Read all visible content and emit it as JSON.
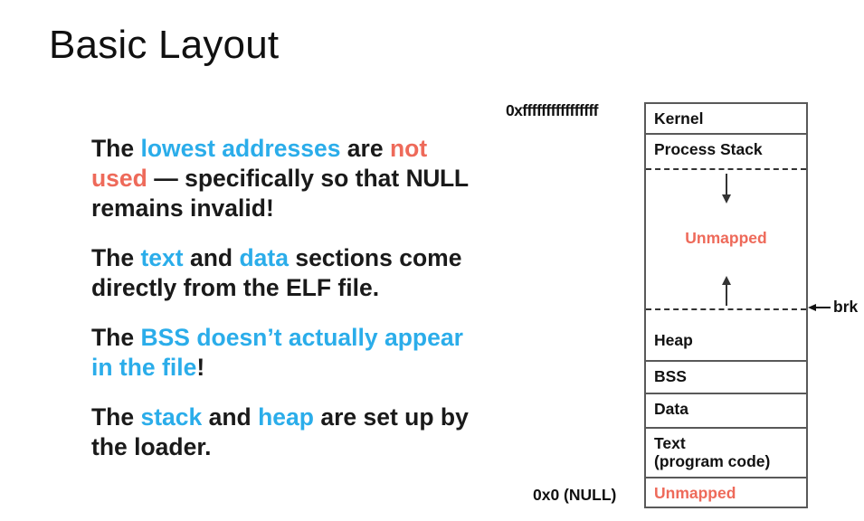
{
  "slide": {
    "title": "Basic Layout"
  },
  "body": {
    "paragraphs": [
      {
        "id": "para-lowest-addresses",
        "segments": [
          {
            "text": "The ",
            "color": "black"
          },
          {
            "text": "lowest addresses",
            "color": "blue"
          },
          {
            "text": " are ",
            "color": "black"
          },
          {
            "text": "not used",
            "color": "red"
          },
          {
            "text": " — specifically so that ",
            "color": "black"
          },
          {
            "text": "NULL",
            "color": "black",
            "style": "mono"
          },
          {
            "text": " remains invalid!",
            "color": "black"
          }
        ]
      },
      {
        "id": "para-text-data",
        "segments": [
          {
            "text": "The ",
            "color": "black"
          },
          {
            "text": "text",
            "color": "blue"
          },
          {
            "text": " and ",
            "color": "black"
          },
          {
            "text": "data",
            "color": "blue"
          },
          {
            "text": " sections come directly from the ELF file.",
            "color": "black"
          }
        ]
      },
      {
        "id": "para-bss",
        "segments": [
          {
            "text": "The ",
            "color": "black"
          },
          {
            "text": "BSS doesn’t actually appear in the file",
            "color": "blue"
          },
          {
            "text": "!",
            "color": "black"
          }
        ]
      },
      {
        "id": "para-stack-heap",
        "segments": [
          {
            "text": "The ",
            "color": "black"
          },
          {
            "text": "stack",
            "color": "blue"
          },
          {
            "text": " and ",
            "color": "black"
          },
          {
            "text": "heap",
            "color": "blue"
          },
          {
            "text": " are set up by the loader.",
            "color": "black"
          }
        ]
      }
    ]
  },
  "diagram": {
    "top_address_label": "0xffffffffffffffff",
    "bottom_address_label": "0x0 (NULL)",
    "brk_label": "brk",
    "regions": [
      {
        "name": "kernel",
        "label": "Kernel",
        "color": "black"
      },
      {
        "name": "process-stack",
        "label": "Process Stack",
        "color": "black"
      },
      {
        "name": "unmapped-upper",
        "label": "Unmapped",
        "color": "red"
      },
      {
        "name": "heap",
        "label": "Heap",
        "color": "black"
      },
      {
        "name": "bss",
        "label": "BSS",
        "color": "black"
      },
      {
        "name": "data",
        "label": "Data",
        "color": "black"
      },
      {
        "name": "text",
        "label": "Text\n(program code)",
        "color": "black"
      },
      {
        "name": "unmapped-lower",
        "label": "Unmapped",
        "color": "red"
      }
    ]
  },
  "colors": {
    "blue": "#2badea",
    "red": "#ee6a5a",
    "text": "#111111",
    "border": "#595959",
    "background": "#ffffff"
  }
}
